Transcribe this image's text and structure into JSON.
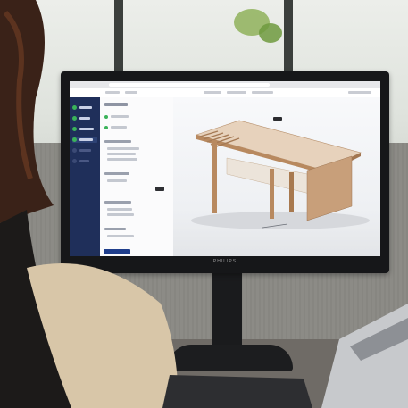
{
  "monitor": {
    "brand": "PHILIPS"
  },
  "colors": {
    "sidebar": "#1f2f5a",
    "status_green": "#3ab35a",
    "accent_blue": "#1f3e8c",
    "wood": "#c89f7a",
    "monitor_frame": "#161719"
  },
  "icons": [
    "status-dot-icon"
  ]
}
